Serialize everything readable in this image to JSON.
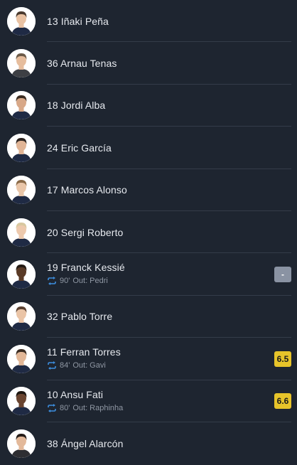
{
  "colors": {
    "background": "#1e2530",
    "divider": "#343c49",
    "name_text": "#e6e9ee",
    "sub_text": "#8f97a3",
    "sub_icon": "#3d8fe0",
    "rating_none": "#8a93a3",
    "rating_good": "#e7c42a"
  },
  "players": [
    {
      "label": "13 Iñaki Peña",
      "skin": "#e9c2a3",
      "hair": "#4a3a2e",
      "kit": "#1f2a44"
    },
    {
      "label": "36 Arnau Tenas",
      "skin": "#e6bd9d",
      "hair": "#6b5a48",
      "kit": "#3d3f44"
    },
    {
      "label": "18 Jordi Alba",
      "skin": "#d8a888",
      "hair": "#3b2c22",
      "kit": "#1f2a44"
    },
    {
      "label": "24 Eric García",
      "skin": "#e1b596",
      "hair": "#2c2420",
      "kit": "#1f2a44"
    },
    {
      "label": "17 Marcos Alonso",
      "skin": "#e9c6a9",
      "hair": "#8a6a48",
      "kit": "#1f2a44"
    },
    {
      "label": "20 Sergi Roberto",
      "skin": "#edc9ad",
      "hair": "#d8c8a0",
      "kit": "#1f2a44"
    },
    {
      "label": "19 Franck Kessié",
      "skin": "#5a3a26",
      "hair": "#231a14",
      "kit": "#1f2a44",
      "sub": {
        "minute": "90'",
        "text": "Out: Pedri"
      },
      "rating": "-",
      "rating_style": "none"
    },
    {
      "label": "32 Pablo Torre",
      "skin": "#eac4a6",
      "hair": "#5a4030",
      "kit": "#1f2a44"
    },
    {
      "label": "11 Ferran Torres",
      "skin": "#e2b797",
      "hair": "#3a2c22",
      "kit": "#1f2a44",
      "sub": {
        "minute": "84'",
        "text": "Out: Gavi"
      },
      "rating": "6.5",
      "rating_style": "score"
    },
    {
      "label": "10 Ansu Fati",
      "skin": "#6a4530",
      "hair": "#1e1712",
      "kit": "#1f2a44",
      "sub": {
        "minute": "80'",
        "text": "Out: Raphinha"
      },
      "rating": "6.6",
      "rating_style": "score"
    },
    {
      "label": "38 Ángel Alarcón",
      "skin": "#e3b99a",
      "hair": "#241c18",
      "kit": "#2e2e32"
    }
  ]
}
